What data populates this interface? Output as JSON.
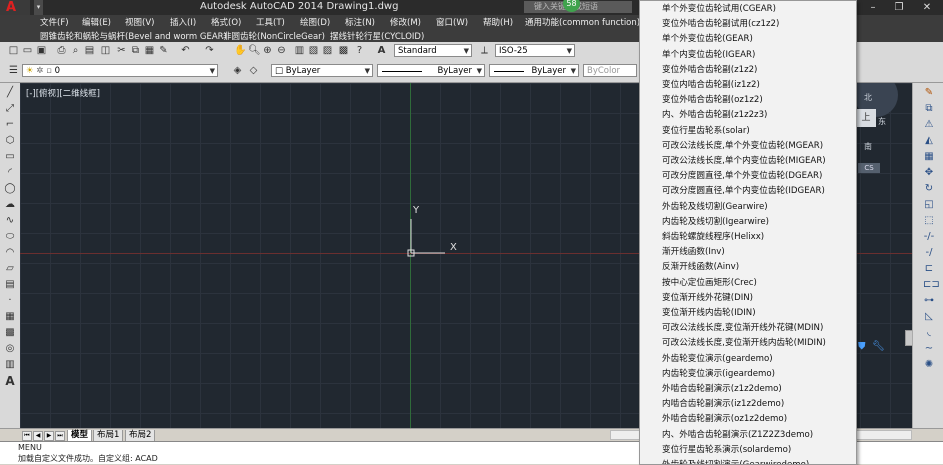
{
  "window": {
    "title": "Autodesk AutoCAD 2014    Drawing1.dwg",
    "search_placeholder": "键入关键字或短语",
    "notif_count": "58"
  },
  "menubar": [
    "文件(F)",
    "编辑(E)",
    "视图(V)",
    "插入(I)",
    "格式(O)",
    "工具(T)",
    "绘图(D)",
    "标注(N)",
    "修改(M)",
    "窗口(W)",
    "帮助(H)",
    "通用功能(common function)"
  ],
  "plugin_menubar": [
    "圆锥齿轮和蜗轮与蜗杆(Bevel and worm GEAR)",
    "非圆齿轮(NonCircleGear)",
    "摆线针轮行星(CYCLOID)"
  ],
  "toolbar1": {
    "text_style": "Standard",
    "dim_style": "ISO-25"
  },
  "toolbar2": {
    "layer": "0",
    "color": "ByLayer",
    "linetype": "ByLayer",
    "lineweight": "ByLayer",
    "plot_style": "ByColor"
  },
  "viewport": {
    "label": "[-][俯视][二维线框]",
    "axis_x": "X",
    "axis_y": "Y"
  },
  "viewcube": {
    "north": "北",
    "top": "上",
    "east": "东",
    "south": "南",
    "wcs": "CS"
  },
  "tabs": [
    "模型",
    "布局1",
    "布局2"
  ],
  "command": {
    "line1": "MENU",
    "line2": "加载自定义文件成功。自定义组: ACAD"
  },
  "popup_menu": [
    "单个外变位齿轮试用(CGEAR)",
    "变位外啮合齿轮副试用(cz1z2)",
    "单个外变位齿轮(GEAR)",
    "单个内变位齿轮(IGEAR)",
    "变位外啮合齿轮副(z1z2)",
    "变位内啮合齿轮副(iz1z2)",
    "变位外啮合齿轮副(oz1z2)",
    "内、外啮合齿轮副(z1z2z3)",
    "变位行星齿轮系(solar)",
    "可改公法线长度,单个外变位齿轮(MGEAR)",
    "可改公法线长度,单个内变位齿轮(MIGEAR)",
    "可改分度圆直径,单个外变位齿轮(DGEAR)",
    "可改分度圆直径,单个内变位齿轮(IDGEAR)",
    "外齿轮及线切割(Gearwire)",
    "内齿轮及线切割(Igearwire)",
    "斜齿轮螺旋线程序(Helixx)",
    "渐开线函数(Inv)",
    "反渐开线函数(Ainv)",
    "按中心定位画矩形(Crec)",
    "变位渐开线外花键(DIN)",
    "变位渐开线内齿轮(IDIN)",
    "可改公法线长度,变位渐开线外花键(MDIN)",
    "可改公法线长度,变位渐开线内齿轮(MIDIN)",
    "外齿轮变位演示(geardemo)",
    "内齿轮变位演示(igeardemo)",
    "外啮合齿轮副演示(z1z2demo)",
    "内啮合齿轮副演示(iz1z2demo)",
    "外啮合齿轮副演示(oz1z2demo)",
    "内、外啮合齿轮副演示(Z1Z2Z3demo)",
    "变位行星齿轮系演示(solardemo)",
    "外齿轮及线切割演示(Gearwiredemo)"
  ]
}
